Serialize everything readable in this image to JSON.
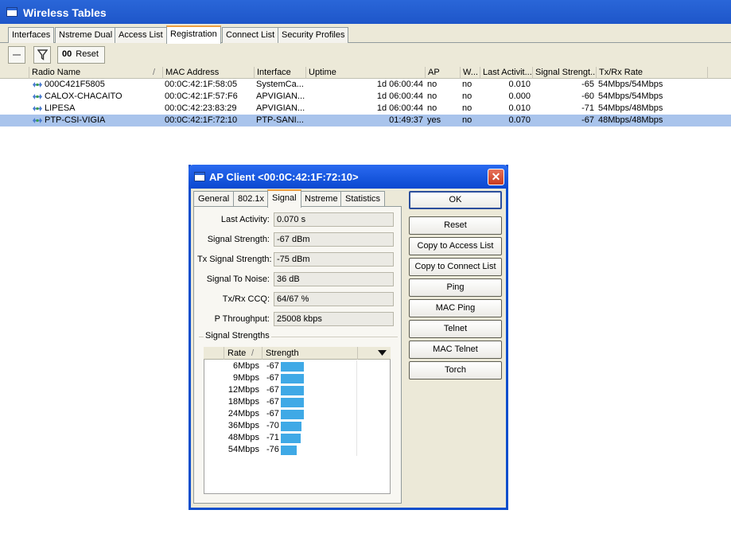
{
  "window": {
    "title": "Wireless Tables"
  },
  "tabs": [
    {
      "label": "Interfaces"
    },
    {
      "label": "Nstreme Dual"
    },
    {
      "label": "Access List"
    },
    {
      "label": "Registration"
    },
    {
      "label": "Connect List"
    },
    {
      "label": "Security Profiles"
    }
  ],
  "toolbar": {
    "reset_icon_text": "00",
    "reset_label": "Reset"
  },
  "table": {
    "columns": [
      "Radio Name",
      "MAC Address",
      "Interface",
      "Uptime",
      "AP",
      "W...",
      "Last Activit...",
      "Signal Strengt...",
      "Tx/Rx Rate"
    ],
    "sort_indicator": "/",
    "rows": [
      {
        "radio_name": "000C421F5805",
        "mac": "00:0C:42:1F:58:05",
        "interface": "SystemCa...",
        "uptime": "1d 06:00:44",
        "ap": "no",
        "w": "no",
        "last_activity": "0.010",
        "signal": "-65",
        "rate": "54Mbps/54Mbps"
      },
      {
        "radio_name": "CALOX-CHACAITO",
        "mac": "00:0C:42:1F:57:F6",
        "interface": "APVIGIAN...",
        "uptime": "1d 06:00:44",
        "ap": "no",
        "w": "no",
        "last_activity": "0.000",
        "signal": "-60",
        "rate": "54Mbps/54Mbps"
      },
      {
        "radio_name": "LIPESA",
        "mac": "00:0C:42:23:83:29",
        "interface": "APVIGIAN...",
        "uptime": "1d 06:00:44",
        "ap": "no",
        "w": "no",
        "last_activity": "0.010",
        "signal": "-71",
        "rate": "54Mbps/48Mbps"
      },
      {
        "radio_name": "PTP-CSI-VIGIA",
        "mac": "00:0C:42:1F:72:10",
        "interface": "PTP-SANI...",
        "uptime": "01:49:37",
        "ap": "yes",
        "w": "no",
        "last_activity": "0.070",
        "signal": "-67",
        "rate": "48Mbps/48Mbps"
      }
    ]
  },
  "dialog": {
    "title": "AP Client <00:0C:42:1F:72:10>",
    "close_glyph": "✕",
    "tabs": [
      {
        "label": "General"
      },
      {
        "label": "802.1x"
      },
      {
        "label": "Signal"
      },
      {
        "label": "Nstreme"
      },
      {
        "label": "Statistics"
      }
    ],
    "fields": [
      {
        "label": "Last Activity:",
        "value": "0.070 s"
      },
      {
        "label": "Signal Strength:",
        "value": "-67 dBm"
      },
      {
        "label": "Tx Signal Strength:",
        "value": "-75 dBm"
      },
      {
        "label": "Signal To Noise:",
        "value": "36 dB"
      },
      {
        "label": "Tx/Rx CCQ:",
        "value": "64/67 %"
      },
      {
        "label": "P Throughput:",
        "value": "25008 kbps"
      }
    ],
    "group_label": "Signal Strengths",
    "strength_columns": {
      "rate": "Rate",
      "strength": "Strength",
      "sort_indicator": "/"
    },
    "strengths": [
      {
        "rate": "6Mbps",
        "value": "-67",
        "level": 0.3
      },
      {
        "rate": "9Mbps",
        "value": "-67",
        "level": 0.3
      },
      {
        "rate": "12Mbps",
        "value": "-67",
        "level": 0.3
      },
      {
        "rate": "18Mbps",
        "value": "-67",
        "level": 0.3
      },
      {
        "rate": "24Mbps",
        "value": "-67",
        "level": 0.3
      },
      {
        "rate": "36Mbps",
        "value": "-70",
        "level": 0.27
      },
      {
        "rate": "48Mbps",
        "value": "-71",
        "level": 0.26
      },
      {
        "rate": "54Mbps",
        "value": "-76",
        "level": 0.21
      }
    ],
    "buttons": {
      "ok": "OK",
      "reset": "Reset",
      "copy_access": "Copy to Access List",
      "copy_connect": "Copy to Connect List",
      "ping": "Ping",
      "mac_ping": "MAC Ping",
      "telnet": "Telnet",
      "mac_telnet": "MAC Telnet",
      "torch": "Torch"
    }
  },
  "colors": {
    "title_bar": "#1e56c9",
    "selected_row": "#a9c4ec",
    "strength_bar": "#3fa9e6",
    "close_button": "#c83c20"
  }
}
